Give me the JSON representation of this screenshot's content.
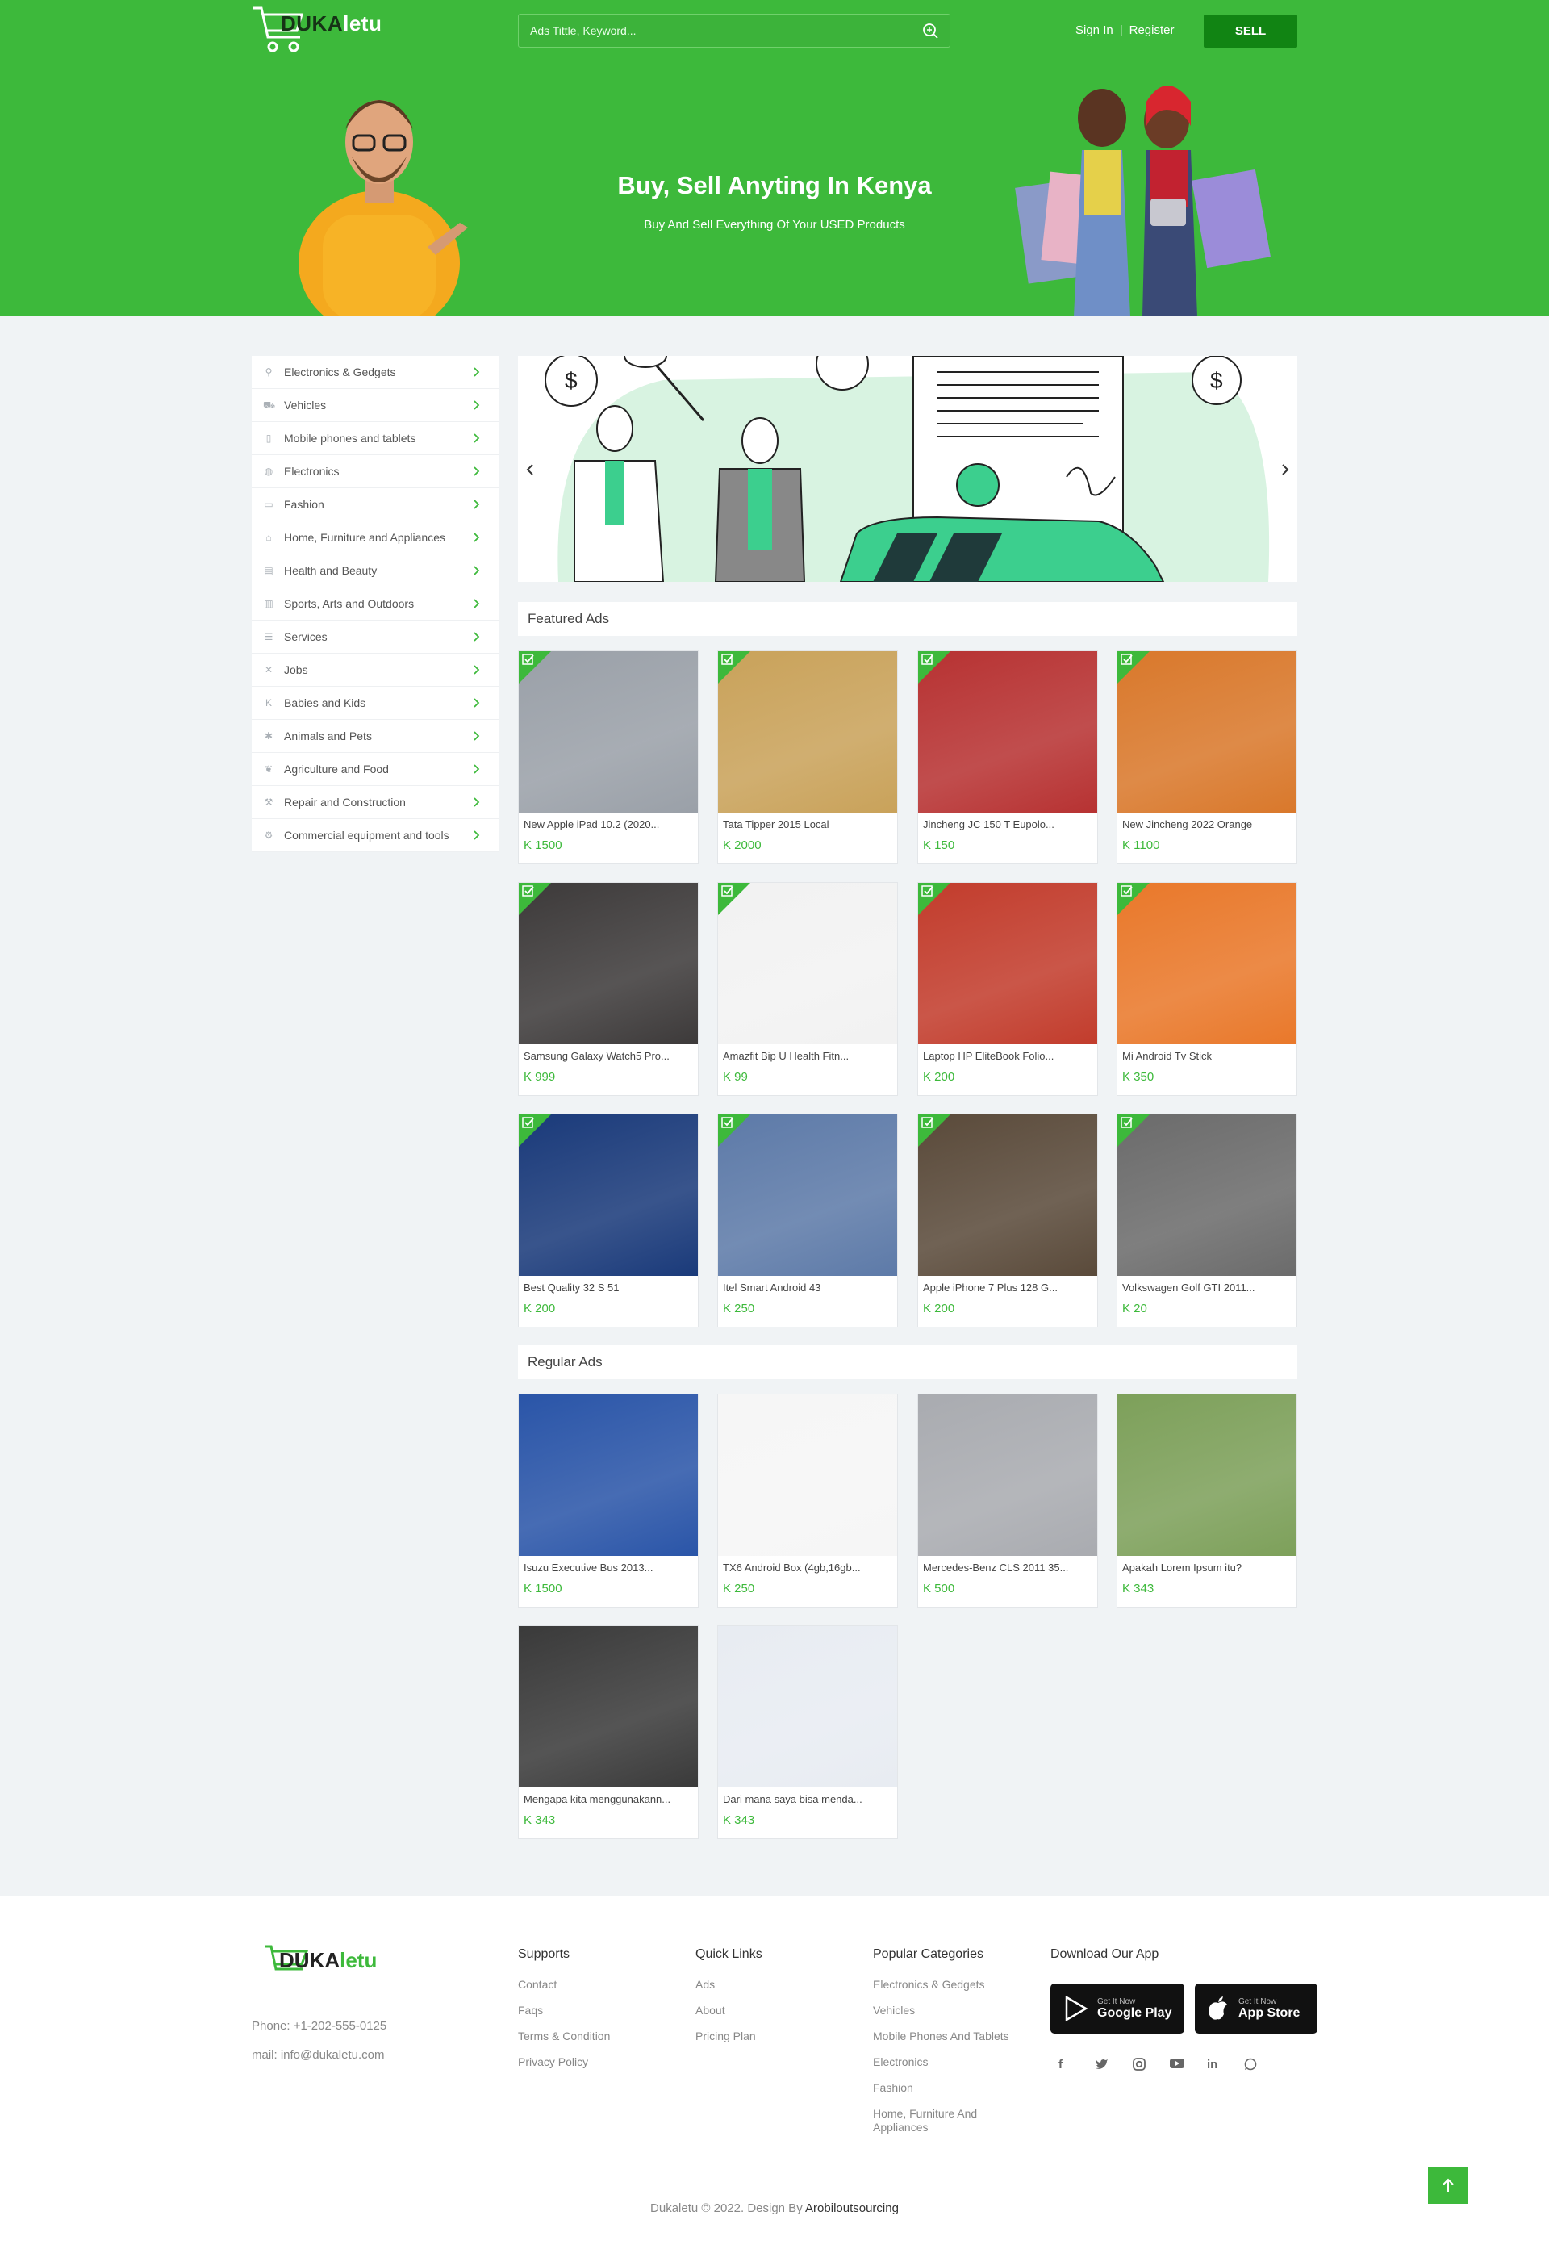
{
  "header": {
    "logo_text_a": "DUKA",
    "logo_text_b": "letu",
    "search_placeholder": "Ads Tittle, Keyword...",
    "sign_in": "Sign In",
    "separator": "|",
    "register": "Register",
    "sell": "SELL"
  },
  "hero": {
    "title": "Buy, Sell Anyting In Kenya",
    "subtitle": "Buy And Sell Everything Of Your USED Products"
  },
  "sidebar": {
    "items": [
      {
        "label": "Electronics & Gedgets",
        "icon": "usb-icon"
      },
      {
        "label": "Vehicles",
        "icon": "car-icon"
      },
      {
        "label": "Mobile phones and tablets",
        "icon": "phone-icon"
      },
      {
        "label": "Electronics",
        "icon": "globe-icon"
      },
      {
        "label": "Fashion",
        "icon": "tag-icon"
      },
      {
        "label": "Home, Furniture and Appliances",
        "icon": "home-icon"
      },
      {
        "label": "Health and Beauty",
        "icon": "heart-icon"
      },
      {
        "label": "Sports, Arts and Outdoors",
        "icon": "ball-icon"
      },
      {
        "label": "Services",
        "icon": "list-icon"
      },
      {
        "label": "Jobs",
        "icon": "briefcase-icon"
      },
      {
        "label": "Babies and Kids",
        "icon": "baby-icon"
      },
      {
        "label": "Animals and Pets",
        "icon": "paw-icon"
      },
      {
        "label": "Agriculture and Food",
        "icon": "leaf-icon"
      },
      {
        "label": "Repair and Construction",
        "icon": "tools-icon"
      },
      {
        "label": "Commercial equipment and tools",
        "icon": "gear-icon"
      }
    ]
  },
  "featured": {
    "heading": "Featured Ads",
    "cards": [
      {
        "title": "New Apple iPad 10.2 (2020...",
        "price": "K 1500",
        "bg": "#9aa0a8"
      },
      {
        "title": "Tata Tipper 2015 Local",
        "price": "K 2000",
        "bg": "#c9a25a"
      },
      {
        "title": "Jincheng JC 150 T Eupolo...",
        "price": "K 150",
        "bg": "#b73232"
      },
      {
        "title": "New Jincheng 2022 Orange",
        "price": "K 1100",
        "bg": "#d9782b"
      },
      {
        "title": "Samsung Galaxy Watch5 Pro...",
        "price": "K 999",
        "bg": "#3d3a3a"
      },
      {
        "title": "Amazfit Bip U Health Fitn...",
        "price": "K 99",
        "bg": "#f2f2f2"
      },
      {
        "title": "Laptop HP EliteBook Folio...",
        "price": "K 200",
        "bg": "#c23c2c"
      },
      {
        "title": "Mi Android Tv Stick",
        "price": "K 350",
        "bg": "#e9782a"
      },
      {
        "title": "Best Quality 32 S 51",
        "price": "K 200",
        "bg": "#1a3a7a"
      },
      {
        "title": "Itel Smart Android 43",
        "price": "K 250",
        "bg": "#5d7aa8"
      },
      {
        "title": "Apple iPhone 7 Plus 128 G...",
        "price": "K 200",
        "bg": "#5a4a3a"
      },
      {
        "title": "Volkswagen Golf GTI 2011...",
        "price": "K 20",
        "bg": "#6b6b6b"
      }
    ]
  },
  "regular": {
    "heading": "Regular Ads",
    "cards": [
      {
        "title": "Isuzu Executive Bus 2013...",
        "price": "K 1500",
        "bg": "#2a55a8"
      },
      {
        "title": "TX6 Android Box (4gb,16gb...",
        "price": "K 250",
        "bg": "#f6f6f6"
      },
      {
        "title": "Mercedes-Benz CLS 2011 35...",
        "price": "K 500",
        "bg": "#a9abb0"
      },
      {
        "title": "Apakah Lorem Ipsum itu?",
        "price": "K 343",
        "bg": "#7da05a"
      },
      {
        "title": "Mengapa kita menggunakann...",
        "price": "K 343",
        "bg": "#3a3a3a"
      },
      {
        "title": "Dari mana saya bisa menda...",
        "price": "K 343",
        "bg": "#e8ecf2"
      }
    ]
  },
  "footer": {
    "logo_text_a": "DUKA",
    "logo_text_b": "letu",
    "phone": "Phone: +1-202-555-0125",
    "mail": "mail: info@dukaletu.com",
    "supports": {
      "heading": "Supports",
      "links": [
        "Contact",
        "Faqs",
        "Terms & Condition",
        "Privacy Policy"
      ]
    },
    "quick_links": {
      "heading": "Quick Links",
      "links": [
        "Ads",
        "About",
        "Pricing Plan"
      ]
    },
    "popular": {
      "heading": "Popular Categories",
      "links": [
        "Electronics & Gedgets",
        "Vehicles",
        "Mobile Phones And Tablets",
        "Electronics",
        "Fashion",
        "Home, Furniture And Appliances"
      ]
    },
    "download": {
      "heading": "Download Our App"
    },
    "google_small": "Get It Now",
    "google_big": "Google Play",
    "apple_small": "Get It Now",
    "apple_big": "App Store",
    "copyright": "Dukaletu © 2022. Design By",
    "designer": "Arobiloutsourcing"
  },
  "colors": {
    "brand": "#3db93b",
    "brand_dark": "#118413"
  }
}
